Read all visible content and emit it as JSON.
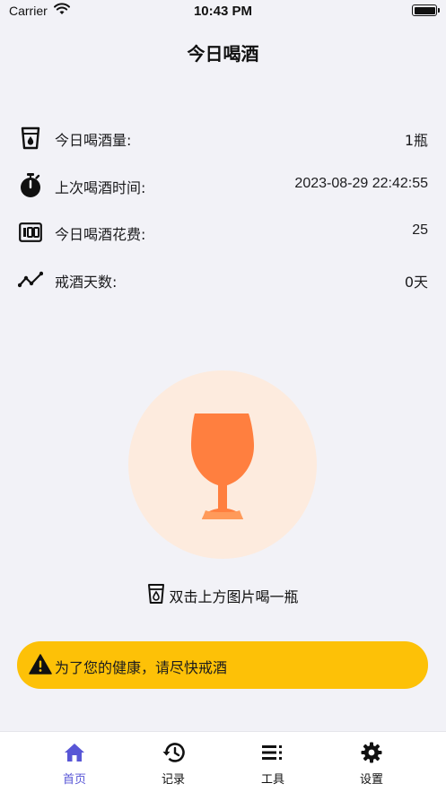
{
  "status_bar": {
    "carrier": "Carrier",
    "time": "10:43 PM"
  },
  "nav": {
    "title": "今日喝酒"
  },
  "stats": [
    {
      "icon": "glass-cup-icon",
      "label": "今日喝酒量:",
      "value": "1瓶"
    },
    {
      "icon": "stopwatch-icon",
      "label": "上次喝酒时间:",
      "value": "2023-08-29 22:42:55"
    },
    {
      "icon": "counter-icon",
      "label": "今日喝酒花费:",
      "value": "25"
    },
    {
      "icon": "trend-icon",
      "label": "戒酒天数:",
      "value": "0天"
    }
  ],
  "drink": {
    "hint": "双击上方图片喝一瓶"
  },
  "banner": {
    "text": "为了您的健康，请尽快戒酒"
  },
  "tabs": [
    {
      "icon": "home-icon",
      "label": "首页",
      "active": true
    },
    {
      "icon": "history-icon",
      "label": "记录",
      "active": false
    },
    {
      "icon": "list-icon",
      "label": "工具",
      "active": false
    },
    {
      "icon": "gear-icon",
      "label": "设置",
      "active": false
    }
  ],
  "colors": {
    "accent": "#5856d6",
    "wine_glass": "#ff7f3f",
    "glass_circle": "#fdebde",
    "banner": "#fdc107",
    "background": "#f2f2f7"
  }
}
